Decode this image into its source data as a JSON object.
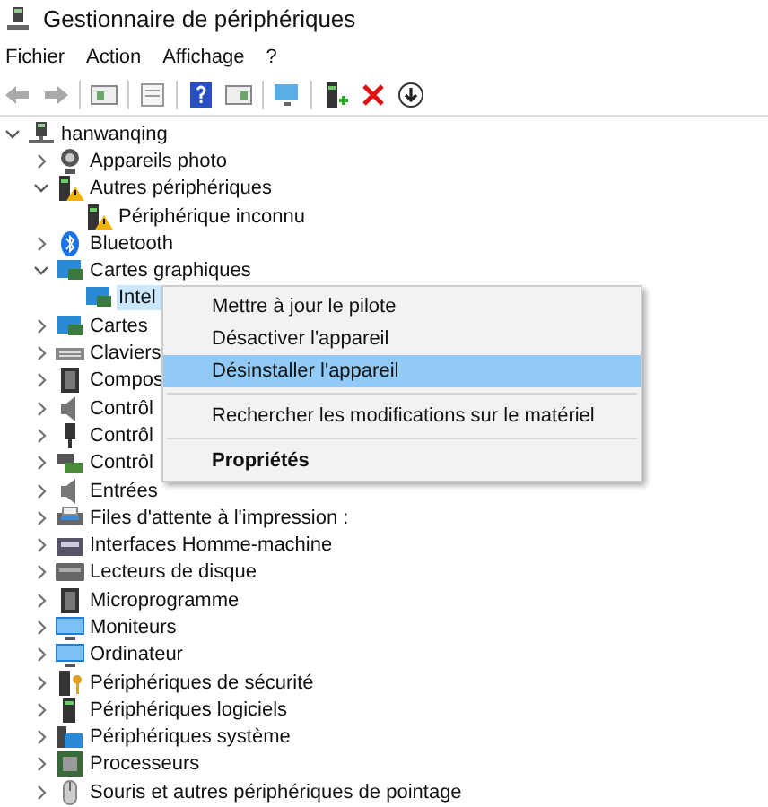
{
  "window": {
    "title": "Gestionnaire de périphériques"
  },
  "menu_bar": [
    "Fichier",
    "Action",
    "Affichage",
    "?"
  ],
  "tree": {
    "label": "hanwanqing",
    "expanded": true,
    "children": [
      {
        "label": "Appareils photo",
        "expanded": false
      },
      {
        "label": "Autres périphériques",
        "expanded": true,
        "children": [
          {
            "label": "Périphérique inconnu"
          }
        ]
      },
      {
        "label": "Bluetooth",
        "expanded": false
      },
      {
        "label": "Cartes graphiques",
        "expanded": true,
        "children": [
          {
            "label": "Intel",
            "selected": true
          }
        ]
      },
      {
        "label": "Cartes",
        "expanded": false
      },
      {
        "label": "Claviers",
        "expanded": false
      },
      {
        "label": "Compos",
        "expanded": false
      },
      {
        "label": "Contrôl",
        "expanded": false
      },
      {
        "label": "Contrôl",
        "expanded": false
      },
      {
        "label": "Contrôl",
        "expanded": false
      },
      {
        "label": "Entrées",
        "expanded": false
      },
      {
        "label": "Files d'attente à l'impression :",
        "expanded": false
      },
      {
        "label": "Interfaces Homme-machine",
        "expanded": false
      },
      {
        "label": "Lecteurs de disque",
        "expanded": false
      },
      {
        "label": "Microprogramme",
        "expanded": false
      },
      {
        "label": "Moniteurs",
        "expanded": false
      },
      {
        "label": "Ordinateur",
        "expanded": false
      },
      {
        "label": "Périphériques de sécurité",
        "expanded": false
      },
      {
        "label": "Périphériques logiciels",
        "expanded": false
      },
      {
        "label": "Périphériques système",
        "expanded": false
      },
      {
        "label": "Processeurs",
        "expanded": false
      },
      {
        "label": "Souris et autres périphériques de pointage",
        "expanded": false
      }
    ]
  },
  "context_menu": [
    {
      "kind": "item",
      "label": "Mettre à jour le pilote",
      "selected": false
    },
    {
      "kind": "item",
      "label": "Désactiver l'appareil",
      "selected": false
    },
    {
      "kind": "item",
      "label": "Désinstaller l'appareil",
      "selected": true
    },
    {
      "kind": "separator"
    },
    {
      "kind": "item",
      "label": "Rechercher les modifications sur le matériel",
      "selected": false
    },
    {
      "kind": "separator"
    },
    {
      "kind": "default",
      "label": "Propriétés",
      "selected": false
    }
  ]
}
